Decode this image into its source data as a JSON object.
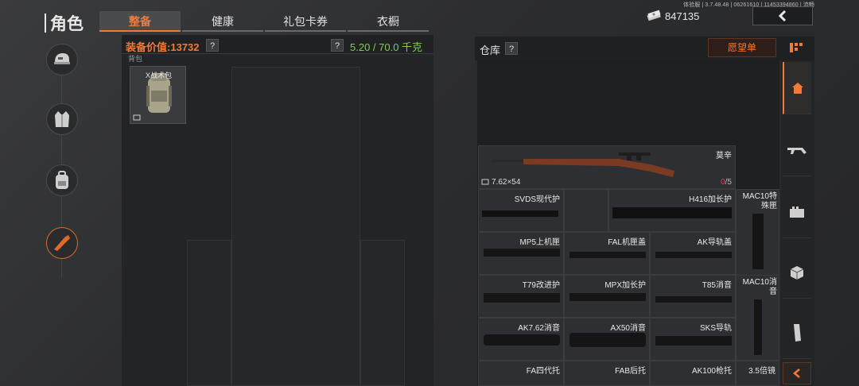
{
  "header": {
    "version_text": "体验服 | 3.7.48.48 | 06261610 | 11453394860 | 流畅",
    "page_title": "角色",
    "tabs": [
      {
        "label": "整备",
        "active": true
      },
      {
        "label": "健康",
        "active": false
      },
      {
        "label": "礼包卡券",
        "active": false
      },
      {
        "label": "衣橱",
        "active": false
      }
    ],
    "currency_icon": "cash-stack-icon",
    "currency_value": "847135",
    "back_icon": "chevron-left-icon"
  },
  "sidebar": {
    "items": [
      {
        "name": "helmet",
        "icon": "helmet-icon",
        "active": false
      },
      {
        "name": "vest",
        "icon": "vest-icon",
        "active": false
      },
      {
        "name": "backpack",
        "icon": "backpack-icon",
        "active": false
      },
      {
        "name": "weapon",
        "icon": "weapon-icon",
        "active": true
      }
    ]
  },
  "equipment": {
    "value_label": "装备价值:",
    "value_number": "13732",
    "help_label": "?",
    "weight_help_label": "?",
    "weight_text": "5.20 / 70.0 千克",
    "backpack_section_label": "背包",
    "backpack_item_name": "X战术包"
  },
  "warehouse": {
    "title": "仓库",
    "help_label": "?",
    "wishlist_label": "愿望单",
    "featured_item": {
      "name": "莫辛",
      "ammo": "7.62×54",
      "count_current": "0",
      "count_total": "/5"
    },
    "items": [
      {
        "name": "SVDS现代护"
      },
      {
        "name": "H416加长护"
      },
      {
        "name": "MAC10特殊匣"
      },
      {
        "name": "MP5上机匣"
      },
      {
        "name": "FAL机匣盖"
      },
      {
        "name": "AK导轨盖"
      },
      {
        "name": "T79改进护"
      },
      {
        "name": "MPX加长护"
      },
      {
        "name": "T85消音"
      },
      {
        "name": "MAC10消音"
      },
      {
        "name": "AK7.62消音"
      },
      {
        "name": "AX50消音"
      },
      {
        "name": "SKS导轨"
      },
      {
        "name": "FA四代托"
      },
      {
        "name": "FAB后托"
      },
      {
        "name": "AK100枪托"
      },
      {
        "name": "3.5倍镜"
      }
    ]
  },
  "categories": [
    {
      "icon": "home-icon",
      "active": true
    },
    {
      "icon": "rifle-icon",
      "active": false
    },
    {
      "icon": "ammo-box-icon",
      "active": false
    },
    {
      "icon": "crate-icon",
      "active": false
    },
    {
      "icon": "magazine-icon",
      "active": false
    },
    {
      "icon": "collapse-left-icon",
      "active": false
    }
  ],
  "colors": {
    "accent": "#f07a3a",
    "weight_green": "#7fcf4a",
    "count_red": "#e04060"
  }
}
